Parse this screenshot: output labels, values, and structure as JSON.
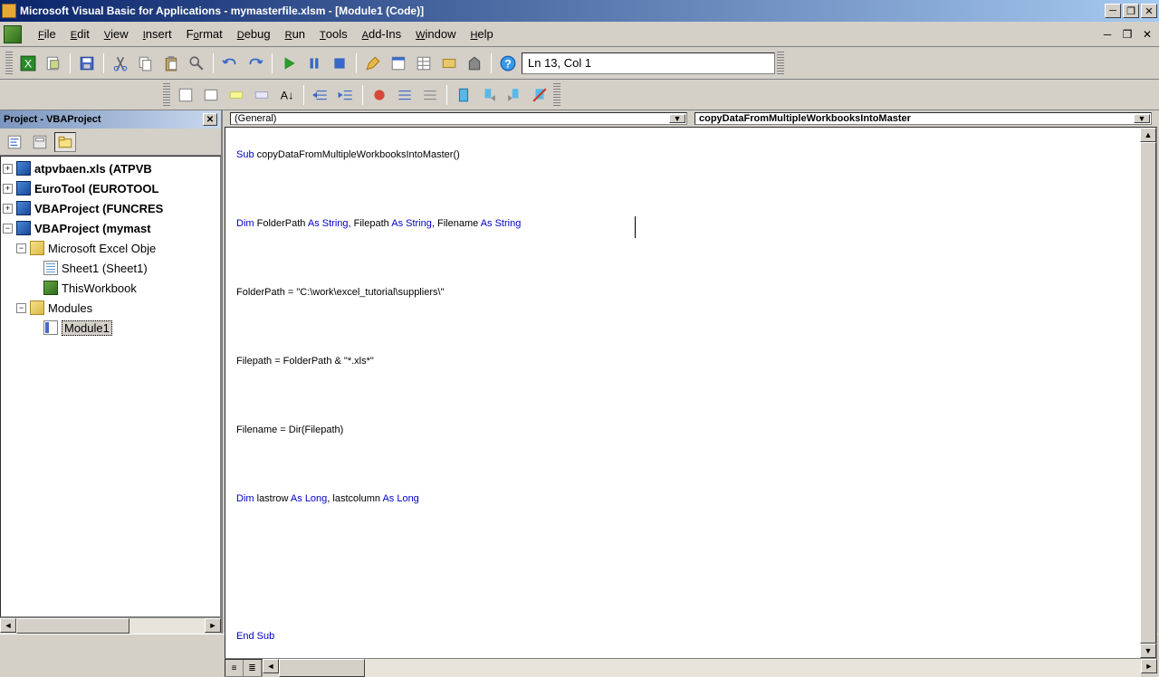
{
  "titlebar": {
    "text": "Microsoft Visual Basic for Applications - mymasterfile.xlsm - [Module1 (Code)]"
  },
  "menubar": {
    "items": [
      {
        "label": "File",
        "key": "F"
      },
      {
        "label": "Edit",
        "key": "E"
      },
      {
        "label": "View",
        "key": "V"
      },
      {
        "label": "Insert",
        "key": "I"
      },
      {
        "label": "Format",
        "key": "o"
      },
      {
        "label": "Debug",
        "key": "D"
      },
      {
        "label": "Run",
        "key": "R"
      },
      {
        "label": "Tools",
        "key": "T"
      },
      {
        "label": "Add-Ins",
        "key": "A"
      },
      {
        "label": "Window",
        "key": "W"
      },
      {
        "label": "Help",
        "key": "H"
      }
    ]
  },
  "toolbar_status": "Ln 13, Col 1",
  "project_panel": {
    "title": "Project - VBAProject",
    "tree": [
      {
        "label": "atpvbaen.xls (ATPVB",
        "bold": true,
        "icon": "vba",
        "exp": "+",
        "indent": 0
      },
      {
        "label": "EuroTool (EUROTOOL",
        "bold": true,
        "icon": "vba",
        "exp": "+",
        "indent": 0
      },
      {
        "label": "VBAProject (FUNCRES",
        "bold": true,
        "icon": "vba",
        "exp": "+",
        "indent": 0
      },
      {
        "label": "VBAProject (mymast",
        "bold": true,
        "icon": "vba",
        "exp": "-",
        "indent": 0
      },
      {
        "label": "Microsoft Excel Obje",
        "bold": false,
        "icon": "folder",
        "exp": "-",
        "indent": 1
      },
      {
        "label": "Sheet1 (Sheet1)",
        "bold": false,
        "icon": "sheet",
        "exp": "",
        "indent": 2
      },
      {
        "label": "ThisWorkbook",
        "bold": false,
        "icon": "book",
        "exp": "",
        "indent": 2
      },
      {
        "label": "Modules",
        "bold": false,
        "icon": "folder",
        "exp": "-",
        "indent": 1
      },
      {
        "label": "Module1",
        "bold": false,
        "icon": "module",
        "exp": "",
        "indent": 2,
        "selected": true
      }
    ]
  },
  "code_dropdowns": {
    "object": "(General)",
    "procedure": "copyDataFromMultipleWorkbooksIntoMaster"
  },
  "code": {
    "l1a": "Sub",
    "l1b": " copyDataFromMultipleWorkbooksIntoMaster()",
    "l2a": "Dim",
    "l2b": " FolderPath ",
    "l2c": "As String",
    "l2d": ", Filepath ",
    "l2e": "As String",
    "l2f": ", Filename ",
    "l2g": "As String",
    "l3": "FolderPath = \"C:\\work\\excel_tutorial\\suppliers\\\"",
    "l4": "Filepath = FolderPath & \"*.xls*\"",
    "l5": "Filename = Dir(Filepath)",
    "l6a": "Dim",
    "l6b": " lastrow ",
    "l6c": "As Long",
    "l6d": ", lastcolumn ",
    "l6e": "As Long",
    "l7": "End Sub"
  }
}
